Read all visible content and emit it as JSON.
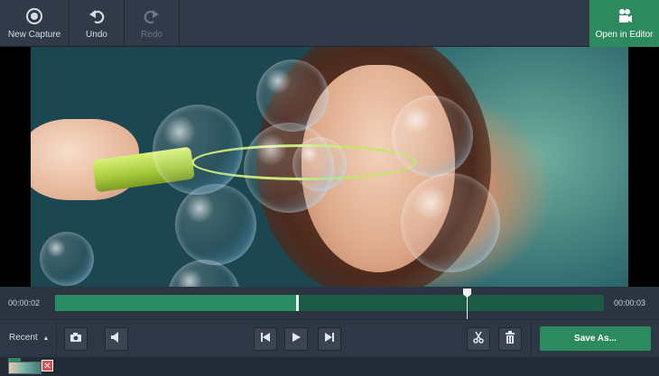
{
  "toolbar": {
    "new_capture_label": "New Capture",
    "undo_label": "Undo",
    "redo_label": "Redo",
    "open_in_editor_label": "Open in Editor"
  },
  "timeline": {
    "current_time": "00:00:02",
    "end_time": "00:00:03",
    "selection_fraction": 0.44,
    "playhead_fraction": 0.75
  },
  "controls": {
    "recent_label": "Recent",
    "save_as_label": "Save As..."
  },
  "recent_strip": {
    "close_glyph": "✕"
  },
  "icons": [
    "record-icon",
    "undo-icon",
    "redo-icon",
    "film-camera-icon",
    "camera-icon",
    "speaker-icon",
    "skip-back-icon",
    "play-icon",
    "skip-forward-icon",
    "scissors-icon",
    "trash-icon",
    "close-icon"
  ],
  "colors": {
    "accent_green": "#2c8a5e",
    "track_dark": "#1d5a45",
    "toolbar_bg": "#303a49"
  }
}
